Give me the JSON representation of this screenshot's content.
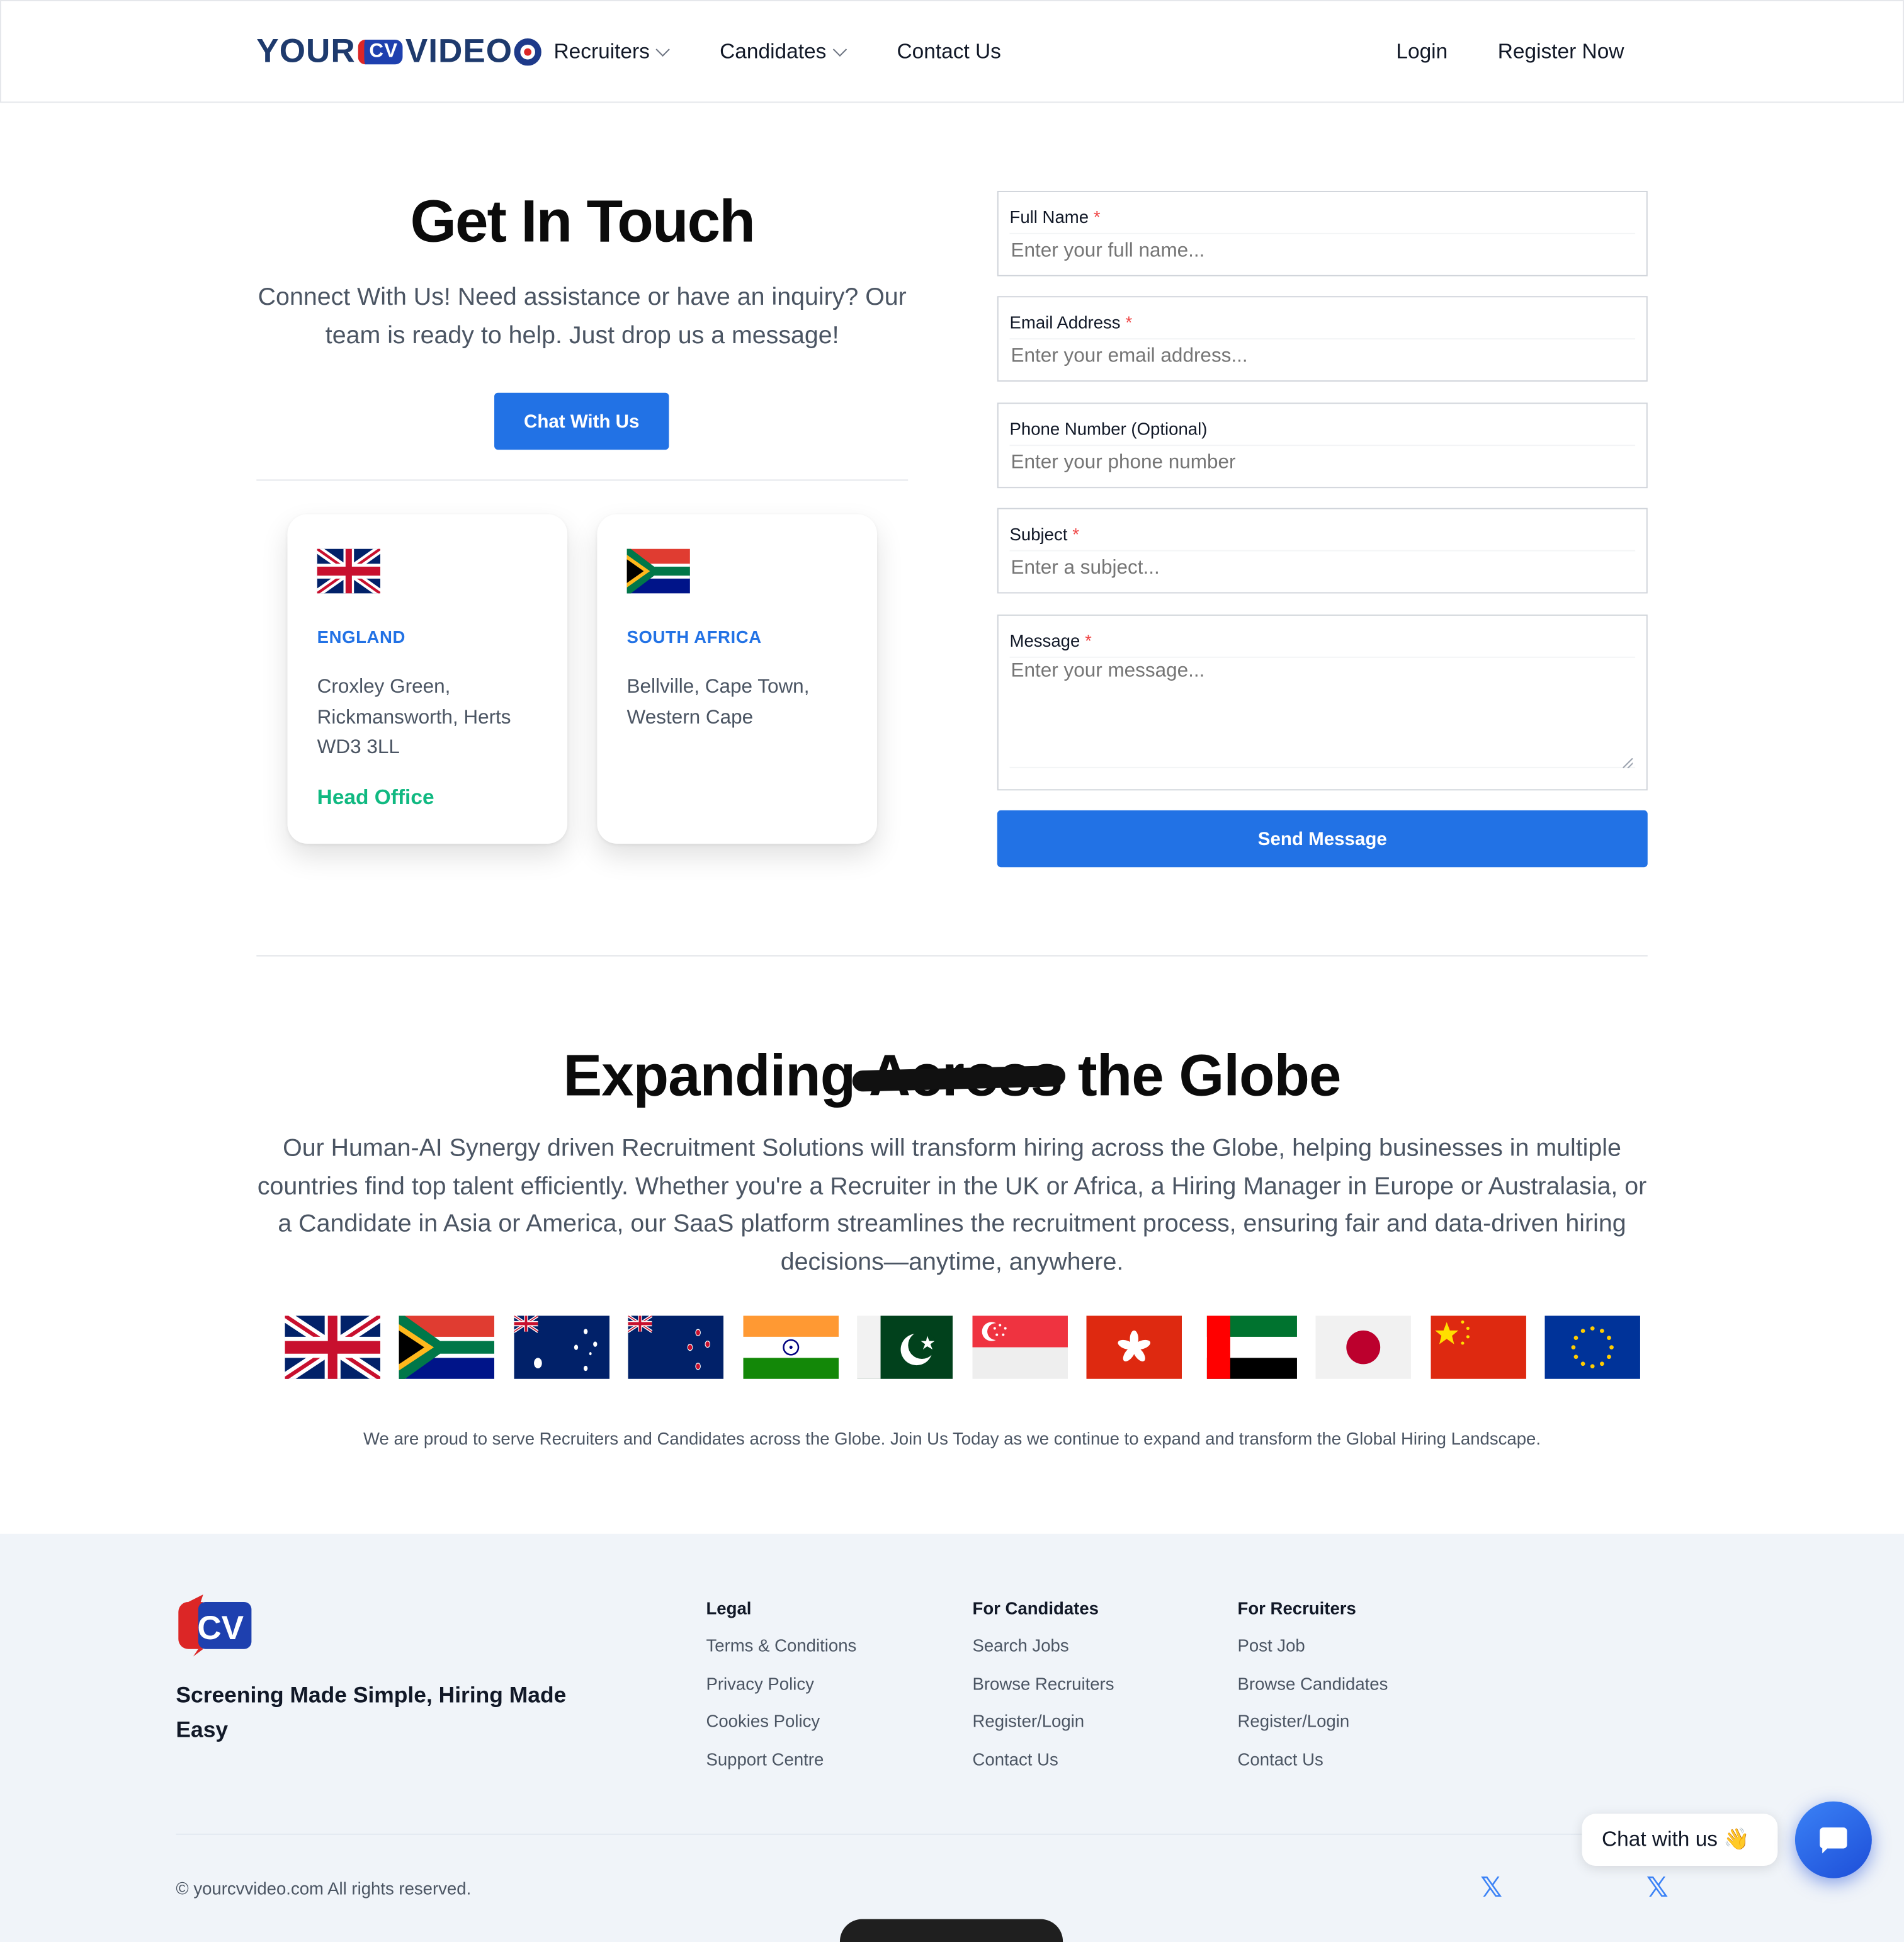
{
  "header": {
    "logo": {
      "part1": "YOUR",
      "cv": "CV",
      "part2": "VIDEO"
    },
    "nav": [
      {
        "label": "Recruiters",
        "has_dropdown": true
      },
      {
        "label": "Candidates",
        "has_dropdown": true
      },
      {
        "label": "Contact Us",
        "has_dropdown": false
      }
    ],
    "login": "Login",
    "register": "Register Now"
  },
  "contact": {
    "title": "Get In Touch",
    "lead": "Connect With Us! Need assistance or have an inquiry? Our team is ready to help. Just drop us a message!",
    "chat_button": "Chat With Us",
    "offices": [
      {
        "country": "ENGLAND",
        "address": "Croxley Green, Rickmansworth, Herts WD3 3LL",
        "badge": "Head Office",
        "flag_icon": "uk-flag-icon"
      },
      {
        "country": "SOUTH AFRICA",
        "address": "Bellville, Cape Town, Western Cape",
        "badge": "",
        "flag_icon": "south-africa-flag-icon"
      }
    ]
  },
  "form": {
    "full_name": {
      "label": "Full Name",
      "required": "*",
      "placeholder": "Enter your full name..."
    },
    "email": {
      "label": "Email Address",
      "required": "*",
      "placeholder": "Enter your email address..."
    },
    "phone": {
      "label": "Phone Number (Optional)",
      "placeholder": "Enter your phone number"
    },
    "subject": {
      "label": "Subject",
      "required": "*",
      "placeholder": "Enter a subject..."
    },
    "message": {
      "label": "Message",
      "required": "*",
      "placeholder": "Enter your message..."
    },
    "submit": "Send Message"
  },
  "globe": {
    "title": "Expanding Across the Globe",
    "paragraph": "Our Human-AI Synergy driven Recruitment Solutions will transform hiring across the Globe, helping businesses in multiple countries find top talent efficiently. Whether you're a Recruiter in the UK or Africa, a Hiring Manager in Europe or Australasia, or a Candidate in Asia or America, our SaaS platform streamlines the recruitment process, ensuring fair and data-driven hiring decisions—anytime, anywhere.",
    "flags": [
      "uk-flag-icon",
      "south-africa-flag-icon",
      "australia-flag-icon",
      "new-zealand-flag-icon",
      "india-flag-icon",
      "pakistan-flag-icon",
      "singapore-flag-icon",
      "hong-kong-flag-icon",
      "uae-flag-icon",
      "japan-flag-icon",
      "china-flag-icon",
      "eu-flag-icon"
    ],
    "note": "We are proud to serve Recruiters and Candidates across the Globe. Join Us Today as we continue to expand and transform the Global Hiring Landscape."
  },
  "footer": {
    "logo": "CV",
    "tagline": "Screening Made Simple, Hiring Made Easy",
    "columns": [
      {
        "heading": "Legal",
        "links": [
          "Terms & Conditions",
          "Privacy Policy",
          "Cookies Policy",
          "Support Centre"
        ]
      },
      {
        "heading": "For Candidates",
        "links": [
          "Search Jobs",
          "Browse Recruiters",
          "Register/Login",
          "Contact Us"
        ]
      },
      {
        "heading": "For Recruiters",
        "links": [
          "Post Job",
          "Browse Candidates",
          "Register/Login",
          "Contact Us"
        ]
      }
    ],
    "copyright": "© yourcvvideo.com All rights reserved.",
    "social_icon": "𝕏"
  },
  "chat_widget": {
    "label": "Chat with us 👋"
  },
  "colors": {
    "accent": "#2272e5",
    "success": "#10b981",
    "footer_bg": "#f0f4f9",
    "required": "#ef4444"
  }
}
